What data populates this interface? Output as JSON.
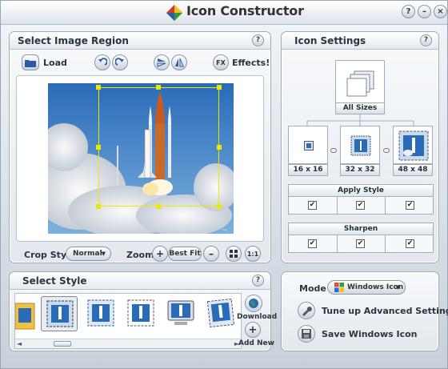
{
  "app": {
    "title": "Icon Constructor"
  },
  "window_buttons": {
    "help": "?",
    "minimize": "–",
    "close": "×"
  },
  "select_region": {
    "title": "Select Image Region",
    "help": "?",
    "load_label": "Load",
    "effects_badge": "FX",
    "effects_label": "Effects!",
    "crop_style_label": "Crop Style :",
    "crop_style_value": "Normal",
    "zoom_label": "Zoom :",
    "zoom_in": "+",
    "zoom_best_fit": "Best Fit",
    "zoom_out": "–",
    "zoom_actual": "1:1"
  },
  "icon_settings": {
    "title": "Icon Settings",
    "help": "?",
    "all_sizes_label": "All Sizes",
    "sizes": [
      {
        "label": "16 x 16"
      },
      {
        "label": "32 x 32"
      },
      {
        "label": "48 x 48"
      }
    ],
    "apply_style_label": "Apply Style",
    "apply_style_checks": [
      true,
      true,
      true
    ],
    "sharpen_label": "Sharpen",
    "sharpen_checks": [
      true,
      true,
      true
    ]
  },
  "select_style": {
    "title": "Select Style",
    "help": "?",
    "styles": [
      "folder-style",
      "stamp-framed-style",
      "stamp-blue-style",
      "stamp-plain-style",
      "monitor-style",
      "stamp-tilted-style"
    ],
    "download_label": "Download",
    "add_new_label": "Add New"
  },
  "mode_panel": {
    "mode_label": "Mode :",
    "mode_value": "Windows Icon",
    "tune_label": "Tune up Advanced Settings",
    "save_label": "Save Windows Icon"
  },
  "colors": {
    "crop_frame": "#e8e800",
    "panel_border": "#9fadbd",
    "accent_blue": "#2a5ba8"
  }
}
